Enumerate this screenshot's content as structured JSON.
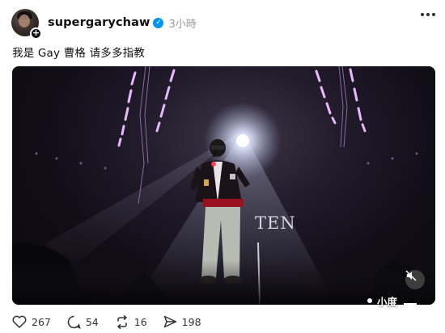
{
  "post": {
    "username": "supergarychaw",
    "time": "3小時",
    "caption": "我是 Gay 曹格 请多多指教"
  },
  "video": {
    "stage_text": "TEN"
  },
  "watermark": {
    "text": "小度"
  },
  "actions": {
    "likes": "267",
    "comments": "54",
    "reposts": "16",
    "shares": "198"
  },
  "colors": {
    "verified": "#0095f6",
    "stage_light": "#e6b8ff"
  }
}
